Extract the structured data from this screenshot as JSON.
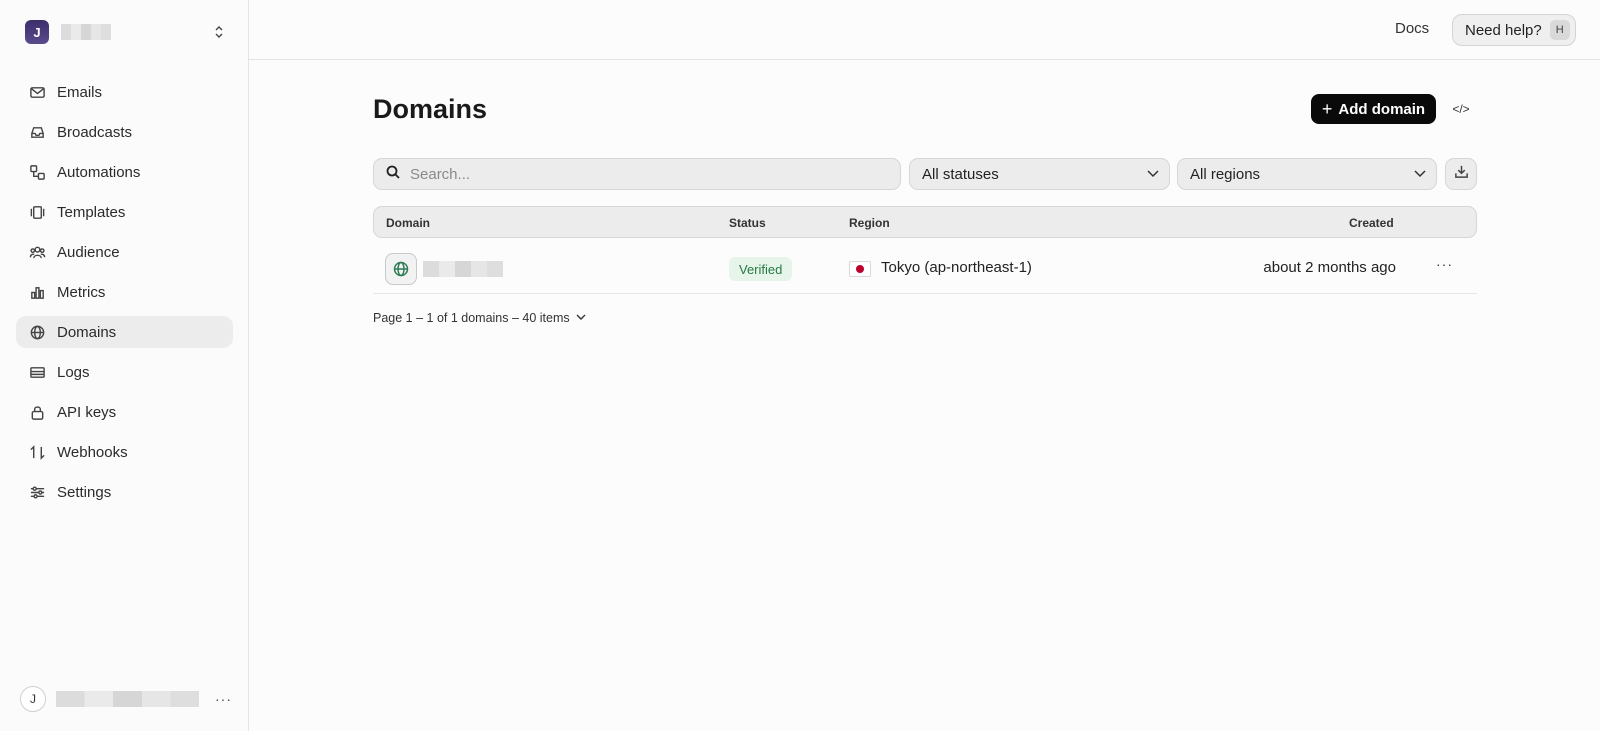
{
  "team": {
    "initial": "J"
  },
  "sidebar": {
    "items": [
      {
        "label": "Emails",
        "icon": "mail-icon"
      },
      {
        "label": "Broadcasts",
        "icon": "inbox-icon"
      },
      {
        "label": "Automations",
        "icon": "workflow-icon"
      },
      {
        "label": "Templates",
        "icon": "templates-icon"
      },
      {
        "label": "Audience",
        "icon": "users-icon"
      },
      {
        "label": "Metrics",
        "icon": "bar-chart-icon"
      },
      {
        "label": "Domains",
        "icon": "globe-icon",
        "active": true
      },
      {
        "label": "Logs",
        "icon": "logs-icon"
      },
      {
        "label": "API keys",
        "icon": "lock-icon"
      },
      {
        "label": "Webhooks",
        "icon": "webhook-icon"
      },
      {
        "label": "Settings",
        "icon": "sliders-icon"
      }
    ]
  },
  "user": {
    "initial": "J",
    "more": "···"
  },
  "topbar": {
    "docs": "Docs",
    "help": "Need help?",
    "help_shortcut": "H"
  },
  "main": {
    "title": "Domains",
    "add_button": "Add domain",
    "code_toggle": "</>",
    "search_placeholder": "Search...",
    "status_filter": "All statuses",
    "region_filter": "All regions",
    "table": {
      "columns": {
        "domain": "Domain",
        "status": "Status",
        "region": "Region",
        "created": "Created"
      },
      "rows": [
        {
          "status": "Verified",
          "region": "Tokyo (ap-northeast-1)",
          "created": "about 2 months ago",
          "more": "···"
        }
      ]
    },
    "pagination": "Page 1 – 1 of 1 domains – 40 items"
  },
  "colors": {
    "accent": "#0a0a0a",
    "verified_bg": "#e6f4ea",
    "verified_text": "#257a45",
    "flag_red": "#bc002d"
  }
}
